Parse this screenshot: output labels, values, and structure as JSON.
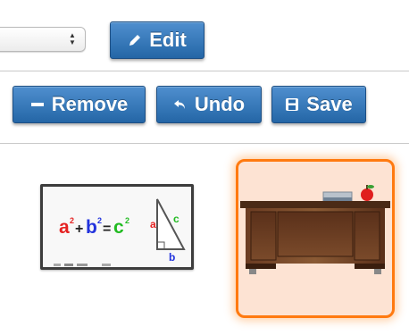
{
  "toolbar": {
    "select": {
      "value": ""
    },
    "edit_label": "Edit",
    "remove_label": "Remove",
    "undo_label": "Undo",
    "save_label": "Save"
  },
  "palette": {
    "items": [
      {
        "name": "whiteboard",
        "formula": "a²+b²=c²",
        "selected": false
      },
      {
        "name": "teacher-desk",
        "selected": true
      }
    ]
  },
  "colors": {
    "button": "#2f74b8",
    "selected_border": "#ff7a10",
    "selected_fill": "#fde3d3"
  },
  "icons": [
    "pencil-icon",
    "minus-icon",
    "undo-icon",
    "save-icon",
    "select-arrows-icon"
  ]
}
